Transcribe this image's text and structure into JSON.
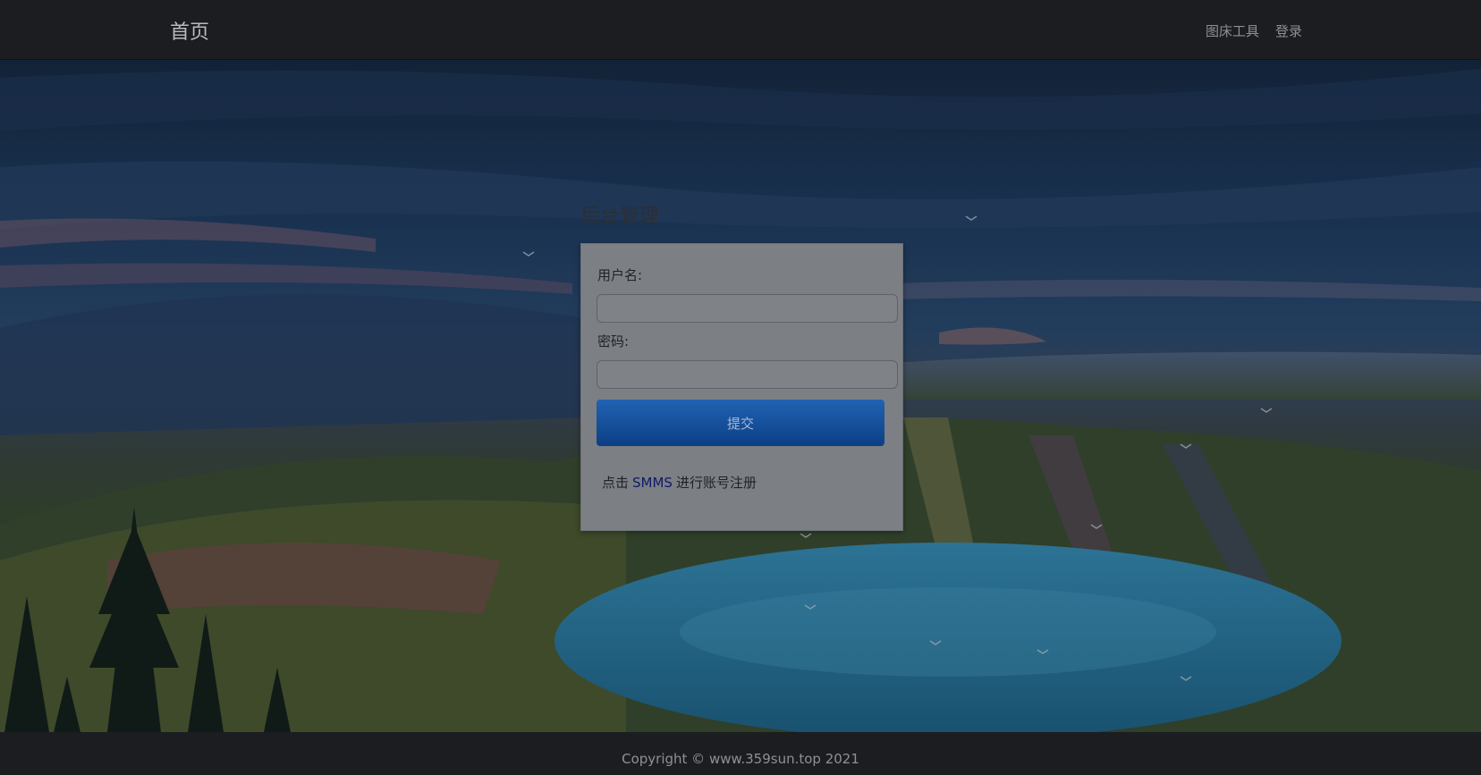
{
  "header": {
    "brand": "首页",
    "nav": {
      "image_host_tool": "图床工具",
      "login": "登录"
    }
  },
  "background": {
    "scene": "painted landscape",
    "colors": {
      "sky_dark": "#162a44",
      "sky_mid": "#2c4f78",
      "lake": "#2a7aa3",
      "hills": "#3b4f2e"
    }
  },
  "login": {
    "title": "后台管理",
    "username_label": "用户名:",
    "username_value": "",
    "password_label": "密码:",
    "password_value": "",
    "submit_label": "提交",
    "register_prefix": "点击",
    "register_link": "SMMS",
    "register_suffix": "进行账号注册"
  },
  "footer": {
    "copyright": "Copyright © www.359sun.top 2021"
  }
}
